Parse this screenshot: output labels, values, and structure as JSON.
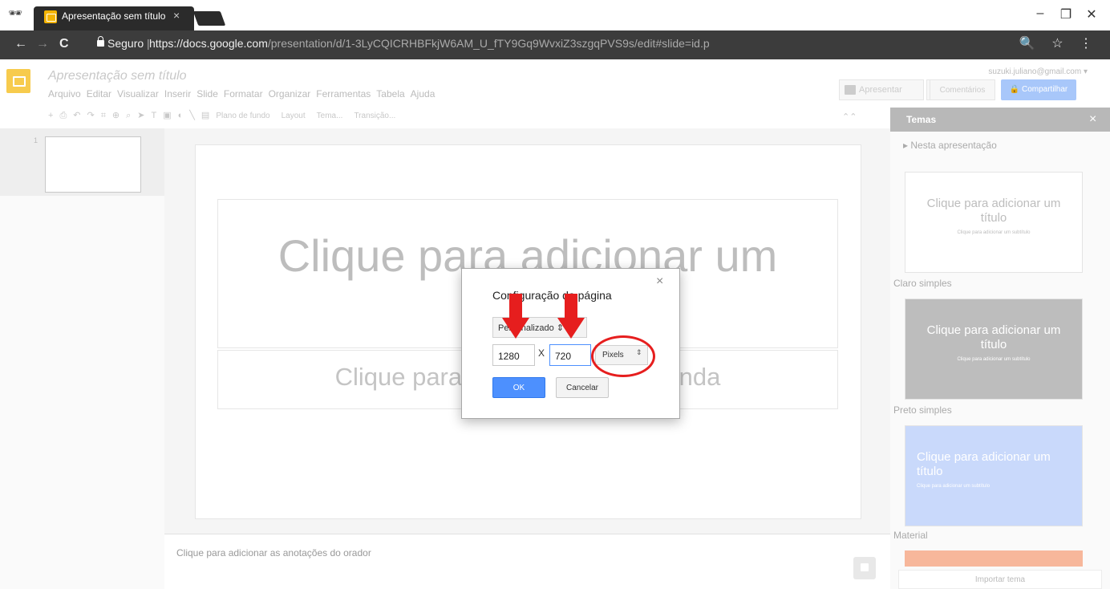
{
  "browser": {
    "tab_title": "Apresentação sem título",
    "tab_close": "×",
    "secure_label": "Seguro",
    "url_host": "https://docs.google.com",
    "url_path": "/presentation/d/1-3LyCQICRHBFkjW6AM_U_fTY9Gq9WvxiZ3szgqPVS9s/edit#slide=id.p",
    "window_controls": {
      "minimize": "–",
      "restore": "❐",
      "close": "✕"
    },
    "nav": {
      "back": "←",
      "forward": "→",
      "reload": "C"
    },
    "right_icons": "🔍 ☆ ⋮"
  },
  "docs": {
    "title": "Apresentação sem título",
    "user_email": "suzuki.juliano@gmail.com",
    "menu": [
      "Arquivo",
      "Editar",
      "Visualizar",
      "Inserir",
      "Slide",
      "Formatar",
      "Organizar",
      "Ferramentas",
      "Tabela",
      "Ajuda"
    ],
    "buttons": {
      "present": "Apresentar",
      "comments": "Comentários",
      "share": "Compartilhar"
    },
    "toolbar_icons": [
      "+",
      "⎙",
      "↶",
      "↷",
      "⌗",
      "⊕",
      "⌕",
      "➤",
      "T",
      "▣",
      "◐",
      "╲",
      "▤"
    ],
    "toolbar_text": [
      "Plano de fundo",
      "Layout",
      "Tema...",
      "Transição..."
    ],
    "collapse_icon": "⌃⌃"
  },
  "filmstrip": {
    "slide_number": "1"
  },
  "slide": {
    "title_placeholder": "Clique para adicionar um",
    "subtitle_placeholder": "Clique para adicionar uma legenda",
    "notes_placeholder": "Clique para adicionar as anotações do orador"
  },
  "themes": {
    "header": "Temas",
    "close": "×",
    "section": "▸ Nesta apresentação",
    "items": [
      {
        "name": "Claro simples",
        "title": "Clique para adicionar um título",
        "subtitle": "Clique para adicionar um subtítulo",
        "bg": "#ffffff",
        "fg": "#bdbdbd"
      },
      {
        "name": "Preto simples",
        "title": "Clique para adicionar um título",
        "subtitle": "Clique para adicionar um subtítulo",
        "bg": "#bdbdbd",
        "fg": "#ffffff"
      },
      {
        "name": "Material",
        "title": "Clique para adicionar um título",
        "subtitle": "Clique para adicionar um subtítulo",
        "bg": "#c9d9fb",
        "fg": "#ffffff"
      }
    ],
    "import_button": "Importar tema"
  },
  "dialog": {
    "title": "Configuração da página",
    "close": "×",
    "preset": "Personalizado",
    "width": "1280",
    "separator": "X",
    "height": "720",
    "unit": "Pixels",
    "ok": "OK",
    "cancel": "Cancelar"
  },
  "colors": {
    "annotation_red": "#e61e1e",
    "accent_blue": "#4d90fe",
    "slides_yellow": "#f7cb4d"
  }
}
